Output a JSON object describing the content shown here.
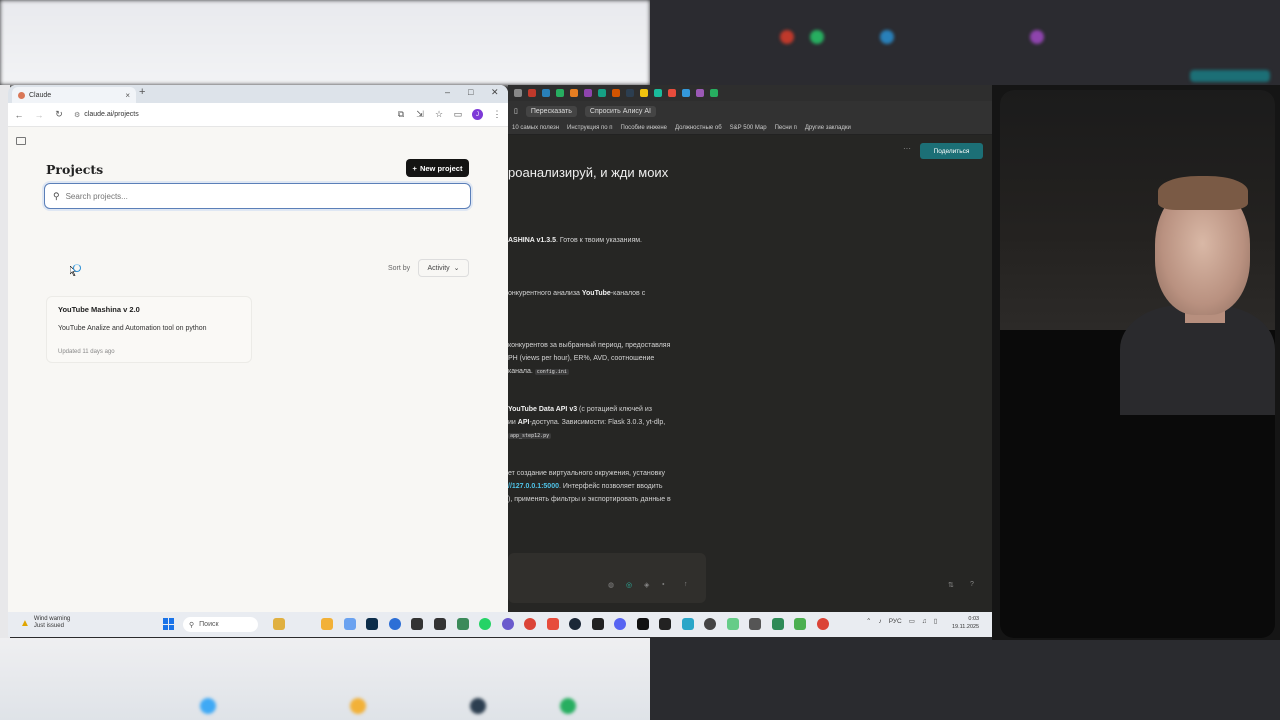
{
  "claude_window": {
    "tab_title": "Claude",
    "url": "claude.ai/projects",
    "avatar_initial": "J"
  },
  "projects_page": {
    "title": "Projects",
    "new_project_label": "New project",
    "search_placeholder": "Search projects...",
    "sort_label": "Sort by",
    "sort_value": "Activity",
    "projects": [
      {
        "title": "YouTube Mashina v 2.0",
        "description": "YouTube Analize and Automation tool on python",
        "updated": "Updated 11 days ago"
      }
    ]
  },
  "dark_window": {
    "toolbar_items": [
      "Пересказать",
      "Спросить Алису AI"
    ],
    "bookmarks": [
      "10 самых полезн",
      "Инструкция по п",
      "Пособие инжене",
      "Должностные об",
      "S&P 500 Map",
      "Песни п",
      "Другие закладки"
    ],
    "share_label": "Поделиться",
    "heading": "роанализируй, и жди моих",
    "lines": [
      {
        "pre": "",
        "bold": "ASHINA v1.3.5",
        "post": ". Готов к твоим указаниям."
      },
      {
        "pre": "онкурентного анализа ",
        "bold": "YouTube",
        "post": "-каналов с"
      },
      {
        "pre": "конкурентов за выбранный период, предоставляя",
        "bold": "",
        "post": ""
      },
      {
        "pre": "PH (views per hour), ER%, AVD, соотношение",
        "bold": "",
        "post": ""
      },
      {
        "pre": " канала.",
        "bold": "",
        "post": "",
        "code": "config.ini"
      },
      {
        "pre": "",
        "bold": "YouTube Data API v3",
        "post": " (с ротацией ключей из"
      },
      {
        "pre": "ии ",
        "bold": "API",
        "post": "-доступа. Зависимости: Flask 3.0.3, yt-dlp,"
      },
      {
        "pre": "",
        "bold": "",
        "post": "",
        "code": "app_step12.py"
      },
      {
        "pre": "ет создание виртуального окружения, установку",
        "bold": "",
        "post": ""
      },
      {
        "pre": "",
        "link": "//127.0.0.1:5000",
        "post": ". Интерфейс позволяет вводить"
      },
      {
        "pre": "), применять фильтры и экспортировать данные в",
        "bold": "",
        "post": ""
      }
    ]
  },
  "taskbar": {
    "weather_title": "Wind warning",
    "weather_sub": "Just issued",
    "search_label": "Поиск",
    "lang": "РУС",
    "time": "0:03",
    "date": "19.11.2025"
  },
  "colors": {
    "claude_bg": "#f8f7f4",
    "new_project_bg": "#141413",
    "search_border": "#5b7fb8",
    "share_btn": "#1c6f76",
    "link": "#4fc3e8"
  }
}
